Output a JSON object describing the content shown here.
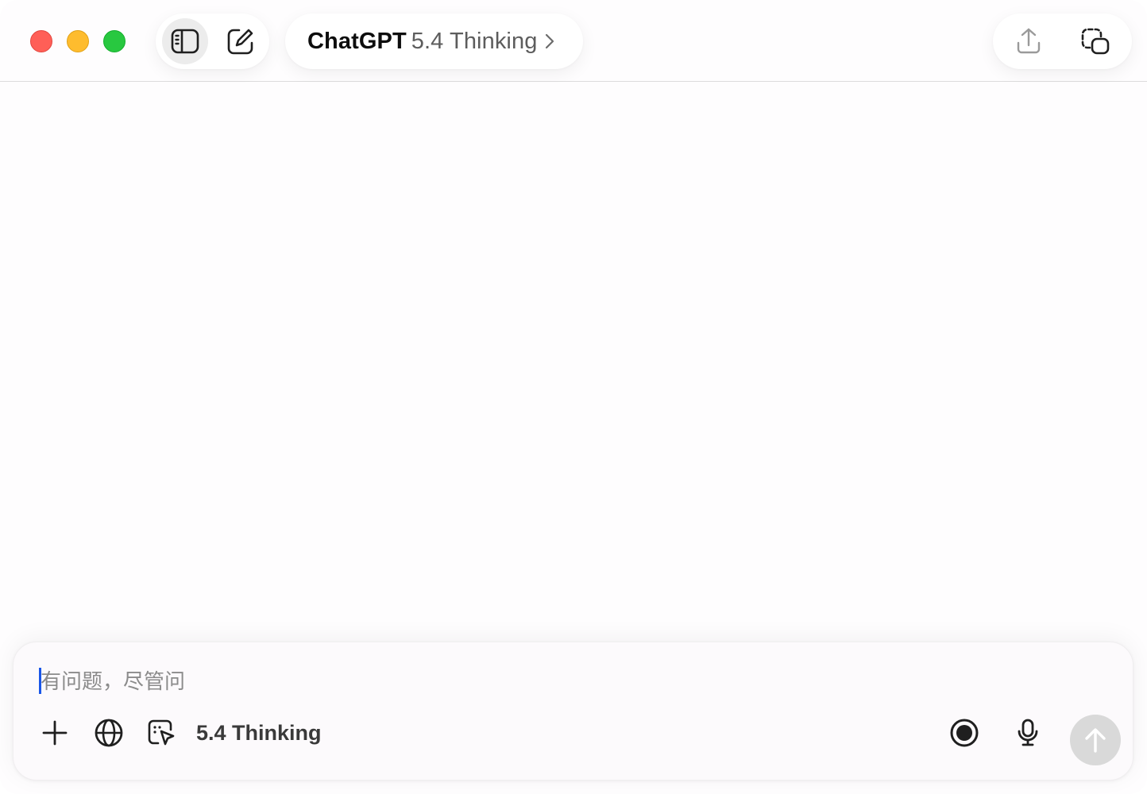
{
  "window": {
    "traffic_lights": [
      "close",
      "minimize",
      "maximize"
    ],
    "colors": {
      "close": "#ff5f57",
      "minimize": "#febc2e",
      "maximize": "#28c840"
    }
  },
  "header": {
    "left_icons": [
      "sidebar-toggle-icon",
      "new-chat-icon"
    ],
    "model_selector": {
      "brand": "ChatGPT",
      "version": "5.4 Thinking",
      "chevron": "chevron-right-icon"
    },
    "right_icons": [
      "share-icon",
      "temporary-chat-icon"
    ]
  },
  "composer": {
    "placeholder": "有问题，尽管问",
    "value": "",
    "tools": [
      "add-icon",
      "globe-icon",
      "screenshot-select-icon"
    ],
    "model_label": "5.4 Thinking",
    "right_icons": [
      "voice-mode-icon",
      "microphone-icon",
      "send-arrow-icon"
    ],
    "caret_color": "#1a56e8"
  }
}
